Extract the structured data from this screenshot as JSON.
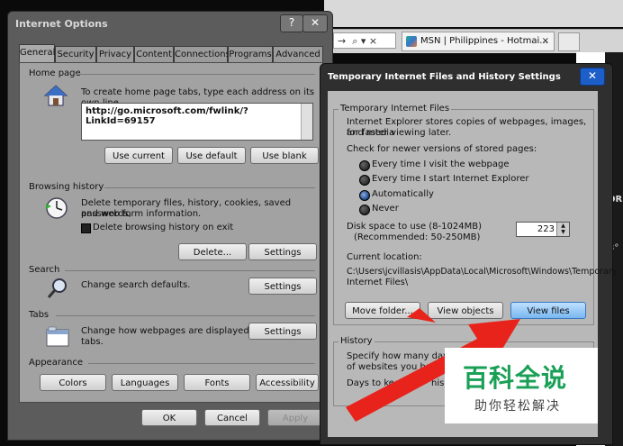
{
  "browser": {
    "address_fragment": "→  ⌕ ▾ ×",
    "tab_label": "MSN | Philippines - Hotmai...",
    "tab_close": "×",
    "side_text_1": "OR",
    "side_text_2": "3°"
  },
  "internet_options": {
    "title": "Internet Options",
    "help_btn": "?",
    "close_btn": "✕",
    "tabs": [
      "General",
      "Security",
      "Privacy",
      "Content",
      "Connections",
      "Programs",
      "Advanced"
    ],
    "home_page": {
      "label": "Home page",
      "description": "To create home page tabs, type each address on its own line.",
      "url": "http://go.microsoft.com/fwlink/?LinkId=69157",
      "use_current": "Use current",
      "use_default": "Use default",
      "use_blank": "Use blank"
    },
    "browsing_history": {
      "label": "Browsing history",
      "description_1": "Delete temporary files, history, cookies, saved passwords,",
      "description_2": "and web form information.",
      "checkbox_label": "Delete browsing history on exit",
      "delete_btn": "Delete...",
      "settings_btn": "Settings"
    },
    "search": {
      "label": "Search",
      "description": "Change search defaults.",
      "settings_btn": "Settings"
    },
    "tabs_section": {
      "label": "Tabs",
      "description_1": "Change how webpages are displayed in",
      "description_2": "tabs.",
      "settings_btn": "Settings"
    },
    "appearance": {
      "label": "Appearance",
      "colors": "Colors",
      "languages": "Languages",
      "fonts": "Fonts",
      "accessibility": "Accessibility"
    },
    "footer": {
      "ok": "OK",
      "cancel": "Cancel",
      "apply": "Apply"
    }
  },
  "tif_dialog": {
    "title": "Temporary Internet Files and History Settings",
    "close_btn": "✕",
    "tif_group": {
      "label": "Temporary Internet Files",
      "description_1": "Internet Explorer stores copies of webpages, images, and media",
      "description_2": "for faster viewing later.",
      "check_label": "Check for newer versions of stored pages:",
      "options": [
        "Every time I visit the webpage",
        "Every time I start Internet Explorer",
        "Automatically",
        "Never"
      ],
      "selected_option": "Automatically",
      "disk_label_1": "Disk space to use (8-1024MB)",
      "disk_label_2": "(Recommended: 50-250MB)",
      "disk_value": "223",
      "location_label": "Current location:",
      "location_1": "C:\\Users\\jcvillasis\\AppData\\Local\\Microsoft\\Windows\\Temporary",
      "location_2": "Internet Files\\",
      "move_folder": "Move folder...",
      "view_objects": "View objects",
      "view_files": "View files"
    },
    "history_group": {
      "label": "History",
      "text_1": "Specify how many days I",
      "text_2": "of websites you have",
      "text_3": "Days to keep",
      "text_3b": "his"
    }
  },
  "watermark": {
    "main": "百科全说",
    "sub": "助你轻松解决"
  },
  "colors": {
    "arrow": "#e8231c",
    "selected_button": "#7ab7f0",
    "watermark_green": "#1aa056"
  }
}
